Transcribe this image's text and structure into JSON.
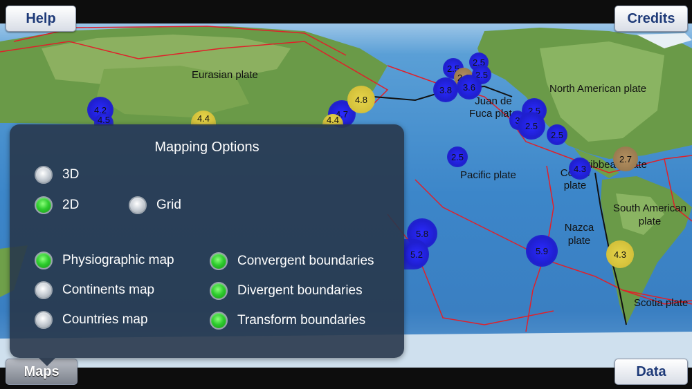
{
  "buttons": {
    "help": "Help",
    "credits": "Credits",
    "maps": "Maps",
    "data": "Data"
  },
  "plates": {
    "eurasian": "Eurasian plate",
    "north_american": "North American plate",
    "juan_de_fuca": "Juan de Fuca plate",
    "pacific": "Pacific plate",
    "caribbean": "Caribbean plate",
    "cocos": "Cocos plate",
    "south_american": "South American plate",
    "nazca": "Nazca plate",
    "scotia": "Scotia plate"
  },
  "quakes": [
    "4.2",
    "4.5",
    "4.4",
    "4.7",
    "4.4",
    "4.8",
    "2.5",
    "2.5",
    "2.6",
    "2.5",
    "3.8",
    "3.6",
    "3",
    "2.5",
    "2.5",
    "2.5",
    "2.5",
    "4.3",
    "2.7",
    "5.8",
    "5.2",
    "5.9",
    "4.3"
  ],
  "panel": {
    "title": "Mapping Options",
    "opt_3d": "3D",
    "opt_2d": "2D",
    "opt_grid": "Grid",
    "opt_physio": "Physiographic map",
    "opt_continents": "Continents map",
    "opt_countries": "Countries map",
    "opt_convergent": "Convergent boundaries",
    "opt_divergent": "Divergent boundaries",
    "opt_transform": "Transform boundaries"
  },
  "state": {
    "3d": false,
    "2d": true,
    "grid": false,
    "physio": true,
    "continents": false,
    "countries": false,
    "convergent": true,
    "divergent": true,
    "transform": true
  },
  "colors": {
    "ocean": "#3c86c9",
    "land": "#6fa04a",
    "boundary": "#e0202a",
    "quake_blue": "#2020e0",
    "quake_yellow": "#d8c640"
  }
}
